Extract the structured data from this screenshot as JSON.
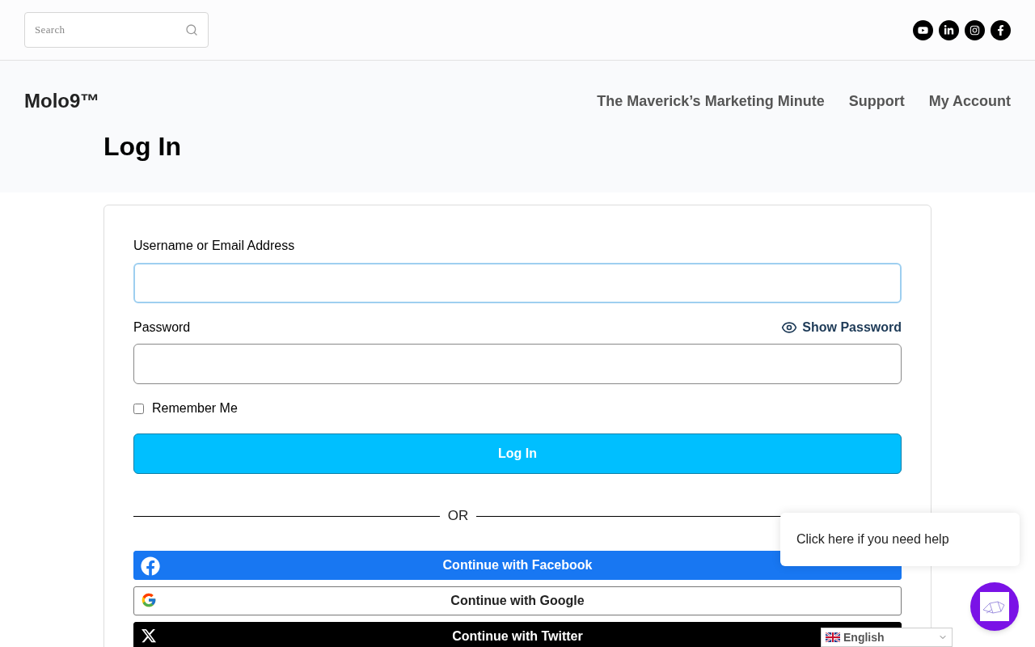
{
  "search": {
    "placeholder": "Search"
  },
  "social_links": [
    {
      "kind": "youtube"
    },
    {
      "kind": "linkedin"
    },
    {
      "kind": "instagram"
    },
    {
      "kind": "facebook"
    }
  ],
  "header": {
    "logo": "Molo9™",
    "nav": [
      {
        "label": "The Maverick’s Marketing Minute"
      },
      {
        "label": "Support"
      },
      {
        "label": "My Account"
      }
    ]
  },
  "page_title": "Log In",
  "form": {
    "username_label": "Username or Email Address",
    "password_label": "Password",
    "show_password": "Show Password",
    "remember": {
      "label": "Remember Me",
      "checked": false
    },
    "submit": "Log In",
    "divider": "OR",
    "social_buttons": [
      {
        "kind": "facebook",
        "label": "Continue with Facebook"
      },
      {
        "kind": "google",
        "label": "Continue with Google"
      },
      {
        "kind": "twitter",
        "label": "Continue with Twitter"
      }
    ]
  },
  "help_bubble": "Click here if you need help",
  "language": "English"
}
